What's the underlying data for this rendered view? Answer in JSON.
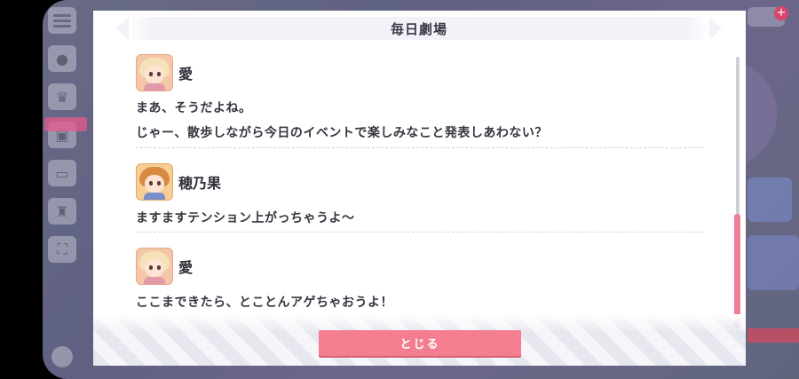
{
  "dialog": {
    "title": "毎日劇場",
    "entries": [
      {
        "speaker": "愛",
        "avatar_icon": "ai-avatar-icon",
        "lines": [
          "まあ、そうだよね。",
          "じゃー、散歩しながら今日のイベントで楽しみなこと発表しあわない？"
        ]
      },
      {
        "speaker": "穂乃果",
        "avatar_icon": "honoka-avatar-icon",
        "lines": [
          "ますますテンション上がっちゃうよ〜"
        ]
      },
      {
        "speaker": "愛",
        "avatar_icon": "ai-avatar-icon",
        "lines": [
          "ここまできたら、とことんアゲちゃおうよ！"
        ]
      }
    ],
    "close_label": "とじる"
  },
  "colors": {
    "accent": "#f27e8f",
    "scrollbar_thumb": "#f07f95",
    "text": "#35353f"
  }
}
